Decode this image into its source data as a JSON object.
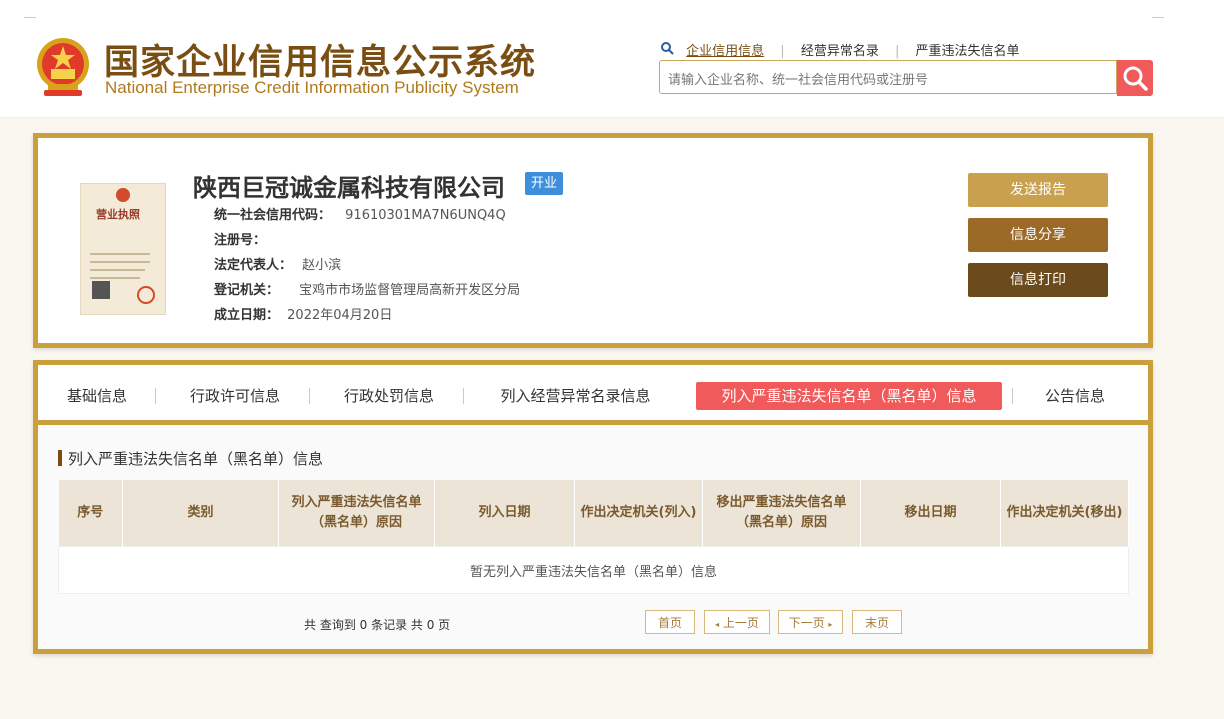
{
  "header": {
    "logo_cn": "国家企业信用信息公示系统",
    "logo_en": "National Enterprise Credit Information Publicity System",
    "links": [
      "企业信用信息",
      "经营异常名录",
      "严重违法失信名单"
    ],
    "search_placeholder": "请输入企业名称、统一社会信用代码或注册号",
    "search_icon": "search-icon",
    "link_icon": "search-icon"
  },
  "company": {
    "name": "陕西巨冠诚金属科技有限公司",
    "status": "开业",
    "credit_code_label": "统一社会信用代码：",
    "credit_code": "91610301MA7N6UNQ4Q",
    "reg_no_label": "注册号：",
    "reg_no": "",
    "legal_rep_label": "法定代表人：",
    "legal_rep": "赵小滨",
    "authority_label": "登记机关：",
    "authority": "宝鸡市市场监督管理局高新开发区分局",
    "est_date_label": "成立日期：",
    "est_date": "2022年04月20日",
    "license_title": "营业执照"
  },
  "actions": {
    "send_report": "发送报告",
    "share": "信息分享",
    "print": "信息打印"
  },
  "tabs": [
    "基础信息",
    "行政许可信息",
    "行政处罚信息",
    "列入经营异常名录信息",
    "列入严重违法失信名单（黑名单）信息",
    "公告信息"
  ],
  "active_tab": 4,
  "section": {
    "title": "列入严重违法失信名单（黑名单）信息",
    "columns": [
      "序号",
      "类别",
      "列入严重违法失信名单（黑名单）原因",
      "列入日期",
      "作出决定机关(列入)",
      "移出严重违法失信名单（黑名单）原因",
      "移出日期",
      "作出决定机关(移出)"
    ],
    "empty_text": "暂无列入严重违法失信名单（黑名单）信息"
  },
  "pagination": {
    "summary": "共 查询到 0 条记录 共 0 页",
    "first": "首页",
    "prev": "上一页",
    "next": "下一页",
    "last": "末页"
  },
  "colors": {
    "gold": "#c9a03c",
    "brown": "#7a4e12",
    "red": "#f05a5a",
    "blue": "#3d8fdc",
    "btn1": "#c9a04d",
    "btn2": "#9a6a26",
    "btn3": "#6b4a1c"
  }
}
